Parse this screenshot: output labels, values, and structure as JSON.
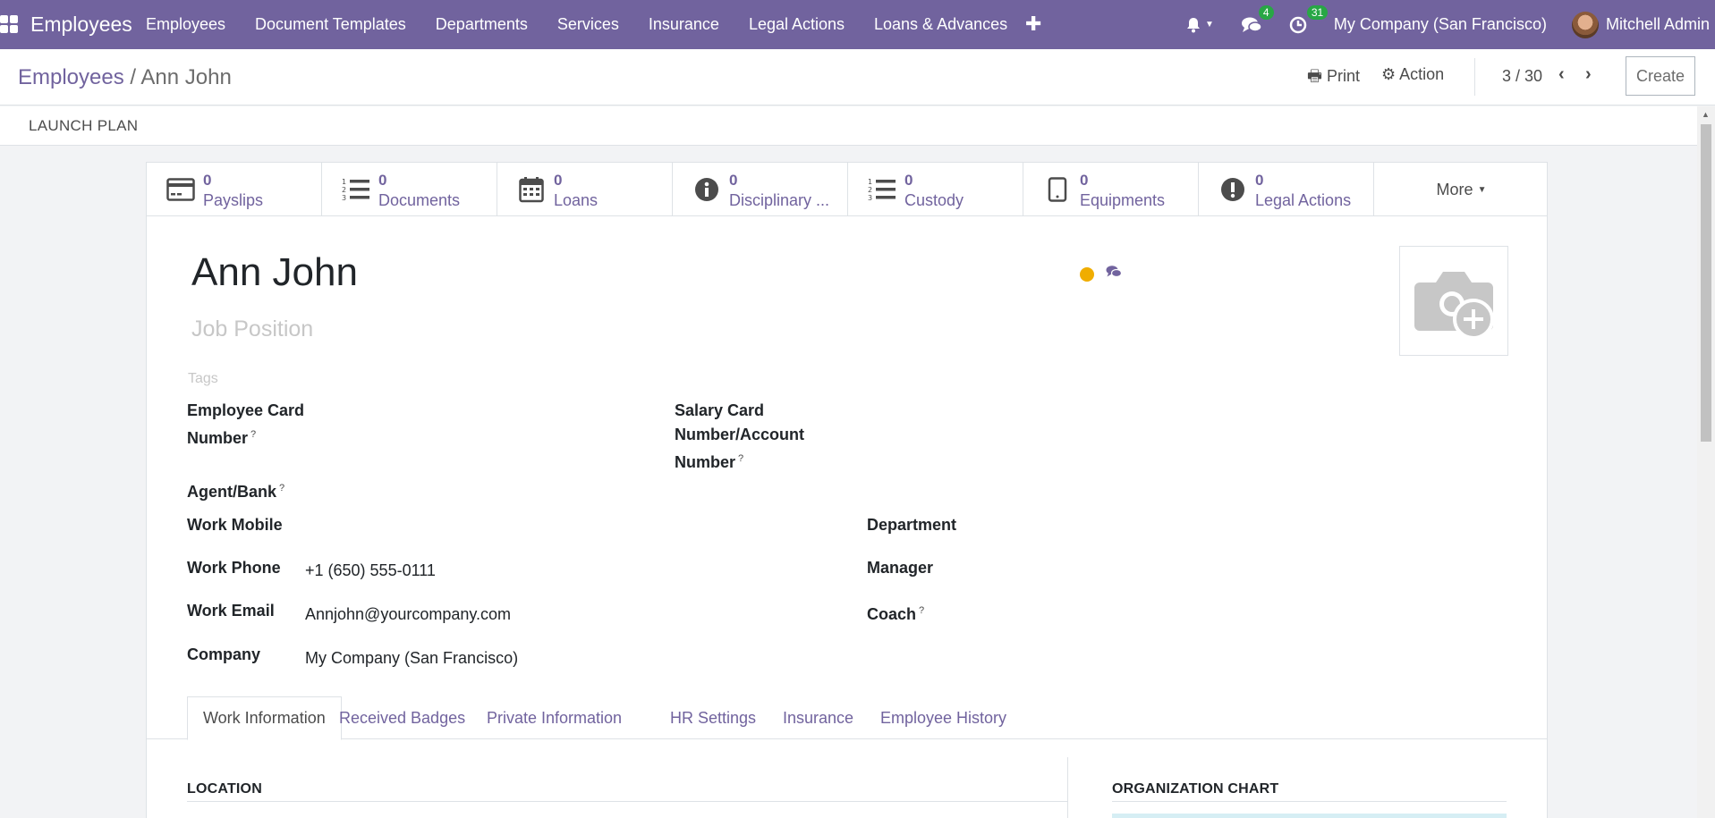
{
  "navbar": {
    "brand": "Employees",
    "menu": [
      "Employees",
      "Document Templates",
      "Departments",
      "Services",
      "Insurance",
      "Legal Actions",
      "Loans & Advances"
    ],
    "plus_icon": "plus-icon",
    "messages_badge": "4",
    "activities_badge": "31",
    "company": "My Company (San Francisco)",
    "user": "Mitchell Admin",
    "color": "#71639e"
  },
  "control": {
    "breadcrumb_parent": "Employees",
    "breadcrumb_sep": " / ",
    "breadcrumb_current": "Ann John",
    "print_label": "Print",
    "action_label": "Action",
    "pager": "3 / 30",
    "create_label": "Create"
  },
  "statusbar": {
    "launch_plan": "LAUNCH PLAN"
  },
  "smart_buttons": [
    {
      "value": "0",
      "label": "Payslips",
      "icon": "credit-card-icon"
    },
    {
      "value": "0",
      "label": "Documents",
      "icon": "list-ol-icon"
    },
    {
      "value": "0",
      "label": "Loans",
      "icon": "calendar-icon"
    },
    {
      "value": "0",
      "label": "Disciplinary ...",
      "icon": "info-circle-icon"
    },
    {
      "value": "0",
      "label": "Custody",
      "icon": "list-ol-icon"
    },
    {
      "value": "0",
      "label": "Equipments",
      "icon": "tablet-icon"
    },
    {
      "value": "0",
      "label": "Legal Actions",
      "icon": "exclamation-circle-icon"
    }
  ],
  "more_label": "More",
  "employee": {
    "name": "Ann John",
    "job_position_placeholder": "Job Position",
    "tags_placeholder": "Tags",
    "status_color": "#f0ad00"
  },
  "fields": {
    "employee_card_label_1": "Employee Card",
    "employee_card_label_2": "Number",
    "salary_card_label_1": "Salary Card",
    "salary_card_label_2": "Number/Account",
    "salary_card_label_3": "Number",
    "agent_bank_label": "Agent/Bank",
    "help_mark": "?",
    "work_mobile_label": "Work Mobile",
    "work_phone_label": "Work Phone",
    "work_phone_value": "+1 (650) 555-0111",
    "work_email_label": "Work Email",
    "work_email_value": "Annjohn@yourcompany.com",
    "company_label": "Company",
    "company_value": "My Company (San Francisco)",
    "department_label": "Department",
    "manager_label": "Manager",
    "coach_label": "Coach"
  },
  "tabs": [
    "Work Information",
    "Received Badges",
    "Private Information",
    "HR Settings",
    "Insurance",
    "Employee History"
  ],
  "sections": {
    "location": "LOCATION",
    "org_chart": "ORGANIZATION CHART"
  }
}
